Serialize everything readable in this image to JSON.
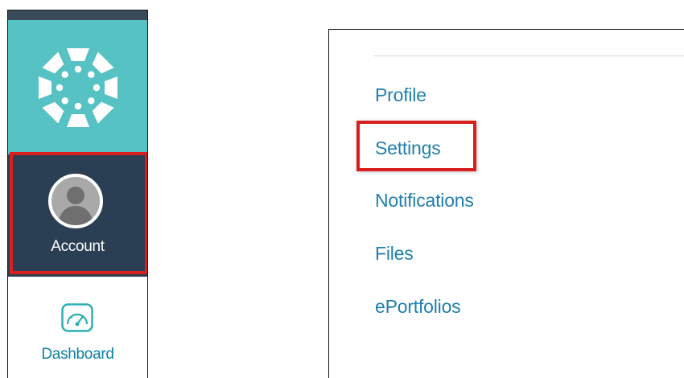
{
  "colors": {
    "nav_top": "#394b58",
    "logo_bg": "#56c2c3",
    "account_bg": "#2a3f54",
    "highlight": "#d81e1e",
    "link": "#1f7fae",
    "dashboard_text": "#0e7fa4"
  },
  "global_nav": {
    "logo_icon": "canvas-logo-icon",
    "account": {
      "label": "Account",
      "icon": "avatar-icon"
    },
    "dashboard": {
      "label": "Dashboard",
      "icon": "speedometer-icon"
    }
  },
  "account_menu": {
    "items": [
      {
        "label": "Profile"
      },
      {
        "label": "Settings"
      },
      {
        "label": "Notifications"
      },
      {
        "label": "Files"
      },
      {
        "label": "ePortfolios"
      }
    ]
  }
}
